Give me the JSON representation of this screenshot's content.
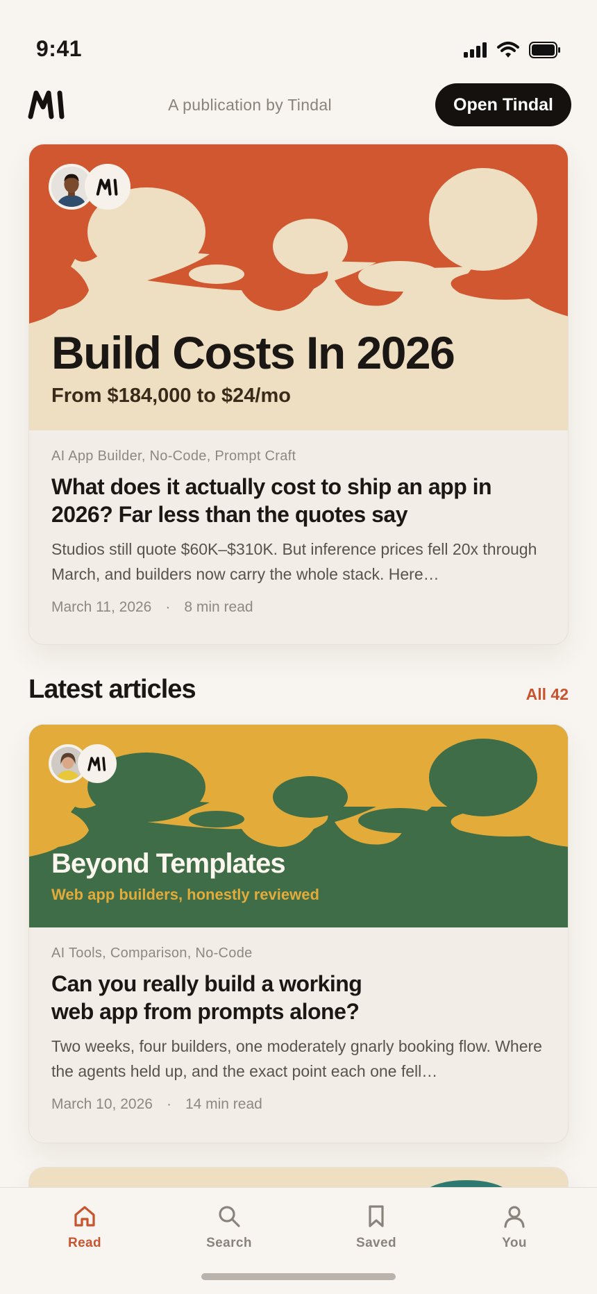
{
  "status": {
    "time": "9:41"
  },
  "header": {
    "publication": "A publication by Tindal",
    "cta": "Open Tindal"
  },
  "featured": {
    "hero_title": "Build Costs In 2026",
    "hero_subtitle": "From $184,000 to $24/mo",
    "tags": "AI App Builder, No-Code, Prompt Craft",
    "title": "What does it actually cost to ship an app in 2026? Far less than the quotes say",
    "excerpt": "Studios still quote $60K–$310K. But inference prices fell 20x through March, and builders now carry the whole stack. Here…",
    "date": "March 11, 2026",
    "read_time": "8 min read",
    "colors": {
      "top": "#d05730",
      "bottom": "#efdfc2"
    }
  },
  "latest": {
    "title": "Latest articles",
    "all_link": "All 42",
    "articles": [
      {
        "hero_title": "Beyond Templates",
        "hero_subtitle": "Web app builders, honestly reviewed",
        "tags": "AI Tools, Comparison, No-Code",
        "title": "Can you really build a working web app from prompts alone?",
        "excerpt": "Two weeks, four builders, one moderately gnarly booking flow. Where the agents held up, and the exact point each one fell…",
        "date": "March 10, 2026",
        "read_time": "14 min read",
        "colors": {
          "top": "#e2ab3a",
          "bottom": "#3e6d48"
        }
      }
    ]
  },
  "tabs": [
    {
      "label": "Read",
      "icon": "home-icon",
      "active": true
    },
    {
      "label": "Search",
      "icon": "search-icon",
      "active": false
    },
    {
      "label": "Saved",
      "icon": "bookmark-icon",
      "active": false
    },
    {
      "label": "You",
      "icon": "person-icon",
      "active": false
    }
  ],
  "separator": "·",
  "accent": "#c8542f"
}
